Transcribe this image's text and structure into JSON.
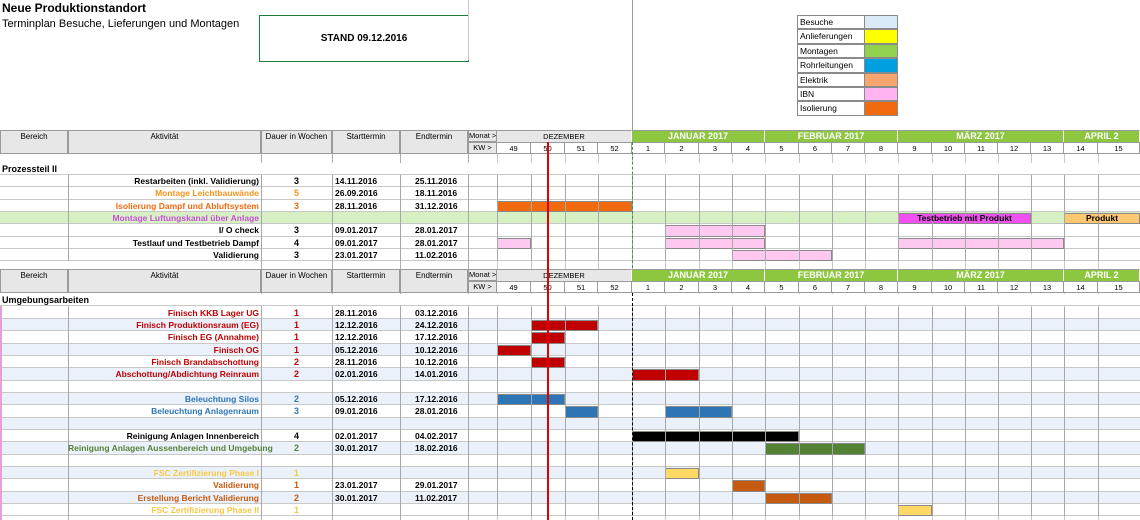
{
  "title": "Neue Produktionstandort",
  "subtitle": "Terminplan Besuche, Lieferungen und Montagen",
  "stand": "STAND   09.12.2016",
  "legend": [
    {
      "label": "Besuche",
      "color": "#dbeaf7"
    },
    {
      "label": "Anlieferungen",
      "color": "#ffff00"
    },
    {
      "label": "Montagen",
      "color": "#92d050"
    },
    {
      "label": "Rohrleitungen",
      "color": "#00a0e0"
    },
    {
      "label": "Elektrik",
      "color": "#f4a66e"
    },
    {
      "label": "IBN",
      "color": "#ffb3f0"
    },
    {
      "label": "Isolierung",
      "color": "#f26a10"
    }
  ],
  "columns": {
    "bereich": "Bereich",
    "aktivitaet": "Aktivität",
    "dauer": "Dauer in Wochen",
    "start": "Starttermin",
    "end": "Endtermin",
    "monat": "Monat >",
    "kw": "KW >"
  },
  "months": [
    {
      "label": "DEZEMBER",
      "style": "plain"
    },
    {
      "label": "JANUAR 2017",
      "style": "green"
    },
    {
      "label": "FEBRUAR 2017",
      "style": "green"
    },
    {
      "label": "MÄRZ 2017",
      "style": "green"
    },
    {
      "label": "APRIL 2",
      "style": "green"
    }
  ],
  "weeks": [
    "49",
    "50",
    "51",
    "52",
    "1",
    "2",
    "3",
    "4",
    "5",
    "6",
    "7",
    "8",
    "9",
    "10",
    "11",
    "12",
    "13",
    "14",
    "15"
  ],
  "section1": {
    "title": "Prozessteil II",
    "rows": [
      {
        "activity": "Restarbeiten (inkl. Validierung)",
        "dauer": "3",
        "start": "14.11.2016",
        "end": "25.11.2016",
        "color": "#000000",
        "bars": []
      },
      {
        "activity": "Montage Leichtbauwände",
        "dauer": "5",
        "start": "26.09.2016",
        "end": "18.11.2016",
        "color": "#f7941d",
        "bars": []
      },
      {
        "activity": "Isolierung  Dampf  und Abluftsystem",
        "dauer": "3",
        "start": "28.11.2016",
        "end": "31.12.2016",
        "color": "#f26a10",
        "bars": [
          {
            "from": 0,
            "to": 4,
            "color": "#f26a10"
          }
        ]
      },
      {
        "activity": "Montage Luftungskanal über Anlage",
        "dauer": "",
        "start": "",
        "end": "",
        "color": "#c84fd8",
        "rowbg": "#d6f0c4",
        "bars": [
          {
            "from": 12,
            "to": 16,
            "color": "#f050f0",
            "label": "Testbetrieb mit Produkt"
          },
          {
            "from": 17,
            "to": 19,
            "color": "#ffc870",
            "label": "Produkt"
          }
        ]
      },
      {
        "activity": "I/ O check",
        "dauer": "3",
        "start": "09.01.2017",
        "end": "28.01.2017",
        "color": "#000000",
        "bars": [
          {
            "from": 5,
            "to": 8,
            "color": "#ffc8f0"
          }
        ]
      },
      {
        "activity": "Testlauf  und Testbetrieb Dampf",
        "dauer": "4",
        "start": "09.01.2017",
        "end": "28.01.2017",
        "color": "#000000",
        "bars": [
          {
            "from": 0,
            "to": 1,
            "color": "#ffc8f0"
          },
          {
            "from": 5,
            "to": 8,
            "color": "#ffc8f0"
          },
          {
            "from": 12,
            "to": 17,
            "color": "#ffc8f0"
          }
        ]
      },
      {
        "activity": "Validierung",
        "dauer": "3",
        "start": "23.01.2017",
        "end": "11.02.2016",
        "color": "#000000",
        "bars": [
          {
            "from": 7,
            "to": 10,
            "color": "#ffc8f0"
          }
        ]
      }
    ]
  },
  "section2": {
    "title": "Umgebungsarbeiten",
    "rows": [
      {
        "activity": "Finisch KKB Lager UG",
        "dauer": "1",
        "start": "28.11.2016",
        "end": "03.12.2016",
        "color": "#c00000",
        "bars": []
      },
      {
        "activity": "Finisch Produktionsraum (EG)",
        "dauer": "1",
        "start": "12.12.2016",
        "end": "24.12.2016",
        "color": "#c00000",
        "bars": [
          {
            "from": 1,
            "to": 3,
            "color": "#c00000"
          }
        ]
      },
      {
        "activity": "Finisch EG (Annahme)",
        "dauer": "1",
        "start": "12.12.2016",
        "end": "17.12.2016",
        "color": "#c00000",
        "bars": [
          {
            "from": 1,
            "to": 2,
            "color": "#c00000"
          }
        ]
      },
      {
        "activity": "Finisch OG",
        "dauer": "1",
        "start": "05.12.2016",
        "end": "10.12.2016",
        "color": "#c00000",
        "bars": [
          {
            "from": 0,
            "to": 1,
            "color": "#c00000"
          }
        ]
      },
      {
        "activity": "Finisch Brandabschottung",
        "dauer": "2",
        "start": "28.11.2016",
        "end": "10.12.2016",
        "color": "#c00000",
        "bars": [
          {
            "from": 1,
            "to": 2,
            "color": "#c00000"
          }
        ]
      },
      {
        "activity": "Abschottung/Abdichtung Reinraum",
        "dauer": "2",
        "start": "02.01.2016",
        "end": "14.01.2016",
        "color": "#c00000",
        "bars": [
          {
            "from": 4,
            "to": 6,
            "color": "#c00000"
          }
        ]
      },
      {
        "activity": "",
        "dauer": "",
        "start": "",
        "end": "",
        "color": "#000000",
        "bars": []
      },
      {
        "activity": "Beleuchtung Silos",
        "dauer": "2",
        "start": "05.12.2016",
        "end": "17.12.2016",
        "color": "#2e75b6",
        "bars": [
          {
            "from": 0,
            "to": 2,
            "color": "#2e75b6"
          }
        ]
      },
      {
        "activity": "Beleuchtung Anlagenraum",
        "dauer": "3",
        "start": "09.01.2016",
        "end": "28.01.2016",
        "color": "#2e75b6",
        "bars": [
          {
            "from": 2,
            "to": 3,
            "color": "#2e75b6"
          },
          {
            "from": 5,
            "to": 7,
            "color": "#2e75b6"
          }
        ]
      },
      {
        "activity": "",
        "dauer": "",
        "start": "",
        "end": "",
        "color": "#000000",
        "bars": []
      },
      {
        "activity": "Reinigung Anlagen Innenbereich",
        "dauer": "4",
        "start": "02.01.2017",
        "end": "04.02.2017",
        "color": "#000000",
        "bars": [
          {
            "from": 4,
            "to": 9,
            "color": "#000000"
          }
        ]
      },
      {
        "activity": "Reinigung Anlagen Aussenbereich und Umgebung",
        "dauer": "2",
        "start": "30.01.2017",
        "end": "18.02.2016",
        "color": "#548235",
        "bars": [
          {
            "from": 8,
            "to": 11,
            "color": "#548235"
          }
        ]
      },
      {
        "activity": "",
        "dauer": "",
        "start": "",
        "end": "",
        "color": "#000000",
        "bars": []
      },
      {
        "activity": "FSC Zertifizierung Phase I",
        "dauer": "1",
        "start": "",
        "end": "",
        "color": "#f7c843",
        "bars": [
          {
            "from": 5,
            "to": 6,
            "color": "#ffd966"
          }
        ]
      },
      {
        "activity": "Validierung",
        "dauer": "1",
        "start": "23.01.2017",
        "end": "29.01.2017",
        "color": "#c55a11",
        "bars": [
          {
            "from": 7,
            "to": 8,
            "color": "#c55a11"
          }
        ]
      },
      {
        "activity": "Erstellung Bericht Validierung",
        "dauer": "2",
        "start": "30.01.2017",
        "end": "11.02.2017",
        "color": "#c55a11",
        "bars": [
          {
            "from": 8,
            "to": 10,
            "color": "#c55a11"
          }
        ]
      },
      {
        "activity": "FSC Zertifizierung Phase II",
        "dauer": "1",
        "start": "",
        "end": "",
        "color": "#f7c843",
        "bars": [
          {
            "from": 12,
            "to": 13,
            "color": "#ffd966"
          }
        ]
      }
    ]
  }
}
